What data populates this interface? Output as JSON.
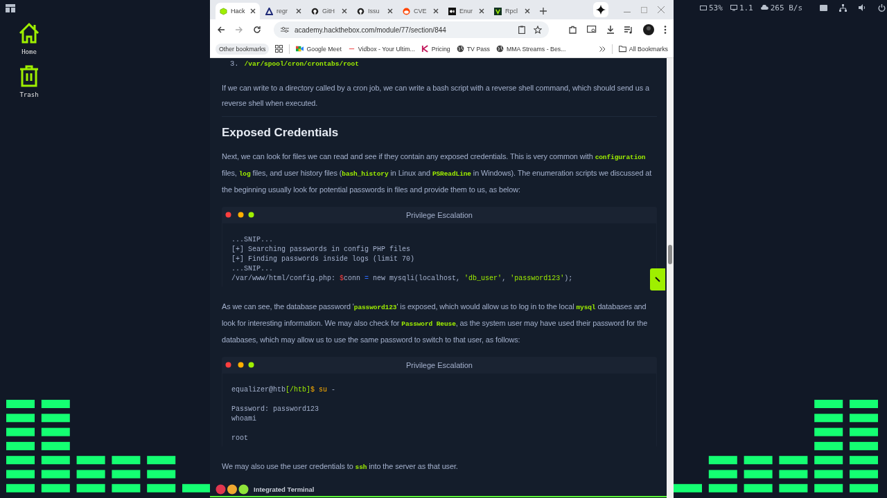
{
  "desktop": {
    "icons": [
      {
        "kind": "home",
        "label": "Home"
      },
      {
        "kind": "trash",
        "label": "Trash"
      }
    ]
  },
  "status_bar": {
    "battery": "53%",
    "load": "1.1",
    "network": "265 B/s"
  },
  "browser": {
    "tabs": [
      {
        "label": "Hack",
        "selected": true
      },
      {
        "label": "regr",
        "selected": false
      },
      {
        "label": "GitH",
        "selected": false
      },
      {
        "label": "Issu",
        "selected": false
      },
      {
        "label": "CVE",
        "selected": false
      },
      {
        "label": "Enur",
        "selected": false
      },
      {
        "label": "Rpcl",
        "selected": false
      }
    ],
    "address": "academy.hackthebox.com/module/77/section/844",
    "other_bookmarks": "Other bookmarks",
    "bookmarks": [
      {
        "label": "Google Meet"
      },
      {
        "label": "Vidbox - Your Ultim..."
      },
      {
        "label": "Pricing"
      },
      {
        "label": "TV Pass"
      },
      {
        "label": "MMA Streams - Bes..."
      }
    ],
    "all_bookmarks": "All Bookmarks"
  },
  "article": {
    "blocks": [
      {
        "kind": "list_item",
        "number": "3.",
        "code": "/var/spool/cron/crontabs/root"
      },
      {
        "kind": "paragraph",
        "segments": [
          {
            "kind": "text",
            "text": "If we can write to a directory called by a cron job, we can write a bash script with a reverse shell command, which should send us a reverse shell when executed."
          }
        ]
      },
      {
        "kind": "rule"
      },
      {
        "kind": "heading",
        "text": "Exposed Credentials"
      },
      {
        "kind": "paragraph",
        "segments": [
          {
            "kind": "text",
            "text": "Next, we can look for files we can read and see if they contain any exposed credentials. This is very common with "
          },
          {
            "kind": "code",
            "text": "configuration"
          },
          {
            "kind": "text",
            "text": " files, "
          },
          {
            "kind": "code",
            "text": "log"
          },
          {
            "kind": "text",
            "text": " files, and user history files ("
          },
          {
            "kind": "code",
            "text": "bash_history"
          },
          {
            "kind": "text",
            "text": " in Linux and "
          },
          {
            "kind": "code",
            "text": "PSReadLine"
          },
          {
            "kind": "text",
            "text": " in Windows). The enumeration scripts we discussed at the beginning usually look for potential passwords in files and provide them to us, as below:"
          }
        ]
      },
      {
        "kind": "code_block",
        "title": "Privilege Escalation",
        "groups": [
          {
            "lines": [
              {
                "segments": [
                  {
                    "kind": "plain",
                    "text": "...SNIP..."
                  }
                ]
              },
              {
                "segments": [
                  {
                    "kind": "plain",
                    "text": "[+] Searching passwords in config PHP files"
                  }
                ]
              },
              {
                "segments": [
                  {
                    "kind": "plain",
                    "text": "[+] Finding passwords inside logs (limit 70)"
                  }
                ]
              },
              {
                "segments": [
                  {
                    "kind": "plain",
                    "text": "...SNIP..."
                  }
                ]
              },
              {
                "segments": [
                  {
                    "kind": "plain",
                    "text": "/var/www/html/config.php: "
                  },
                  {
                    "kind": "red",
                    "text": "$"
                  },
                  {
                    "kind": "plain",
                    "text": "conn "
                  },
                  {
                    "kind": "blue",
                    "text": "="
                  },
                  {
                    "kind": "plain",
                    "text": " new mysqli(localhost, "
                  },
                  {
                    "kind": "green",
                    "text": "'db_user'"
                  },
                  {
                    "kind": "plain",
                    "text": ", "
                  },
                  {
                    "kind": "green",
                    "text": "'password123'"
                  },
                  {
                    "kind": "plain",
                    "text": ");"
                  }
                ]
              }
            ]
          }
        ]
      },
      {
        "kind": "paragraph",
        "segments": [
          {
            "kind": "text",
            "text": "As we can see, the database password '"
          },
          {
            "kind": "code",
            "text": "password123"
          },
          {
            "kind": "text",
            "text": "' is exposed, which would allow us to log in to the local "
          },
          {
            "kind": "code",
            "text": "mysql"
          },
          {
            "kind": "text",
            "text": " databases and look for interesting information. We may also check for "
          },
          {
            "kind": "code",
            "text": "Password Reuse"
          },
          {
            "kind": "text",
            "text": ", as the system user may have used their password for the databases, which may allow us to use the same password to switch to that user, as follows:"
          }
        ]
      },
      {
        "kind": "code_block",
        "title": "Privilege Escalation",
        "groups": [
          {
            "lines": [
              {
                "segments": [
                  {
                    "kind": "plain",
                    "text": "equalizer@htb"
                  },
                  {
                    "kind": "green",
                    "text": "[/htb]"
                  },
                  {
                    "kind": "orange",
                    "text": "$"
                  },
                  {
                    "kind": "orange",
                    "text": " su"
                  },
                  {
                    "kind": "plain",
                    "text": " -"
                  }
                ]
              }
            ]
          },
          {
            "lines": [
              {
                "segments": [
                  {
                    "kind": "plain",
                    "text": "Password: password123"
                  }
                ]
              },
              {
                "segments": [
                  {
                    "kind": "plain",
                    "text": "whoami"
                  }
                ]
              }
            ]
          },
          {
            "lines": [
              {
                "segments": [
                  {
                    "kind": "plain",
                    "text": "root"
                  }
                ]
              }
            ]
          }
        ]
      },
      {
        "kind": "paragraph",
        "segments": [
          {
            "kind": "text",
            "text": "We may also use the user credentials to "
          },
          {
            "kind": "code",
            "text": "ssh"
          },
          {
            "kind": "text",
            "text": " into the server as that user."
          }
        ]
      }
    ]
  },
  "terminal_bar": {
    "label": "Integrated Terminal"
  }
}
